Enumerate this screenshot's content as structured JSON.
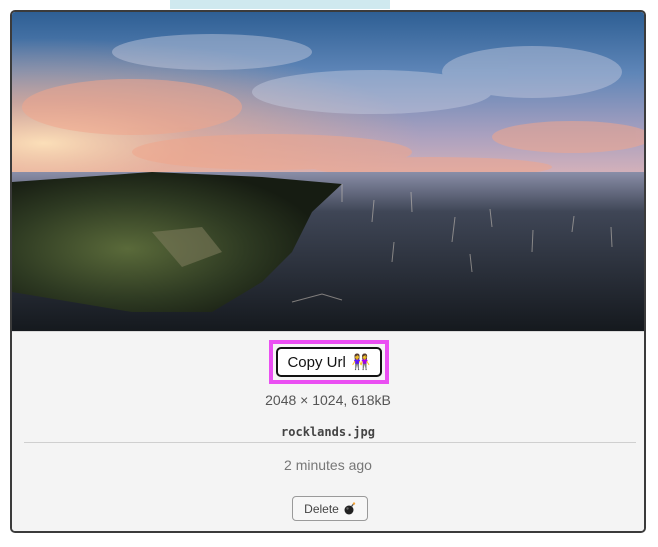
{
  "card": {
    "copy_button_label": "Copy Url",
    "copy_button_icon": "two-people-icon",
    "dimensions": "2048 × 1024, 618kB",
    "filename": "rocklands.jpg",
    "timestamp": "2 minutes ago",
    "delete_button_label": "Delete",
    "delete_button_icon": "bomb-icon"
  },
  "colors": {
    "highlight": "#ea4ff2",
    "card_border": "#3b3b3b",
    "card_background": "#f2f2f2"
  }
}
